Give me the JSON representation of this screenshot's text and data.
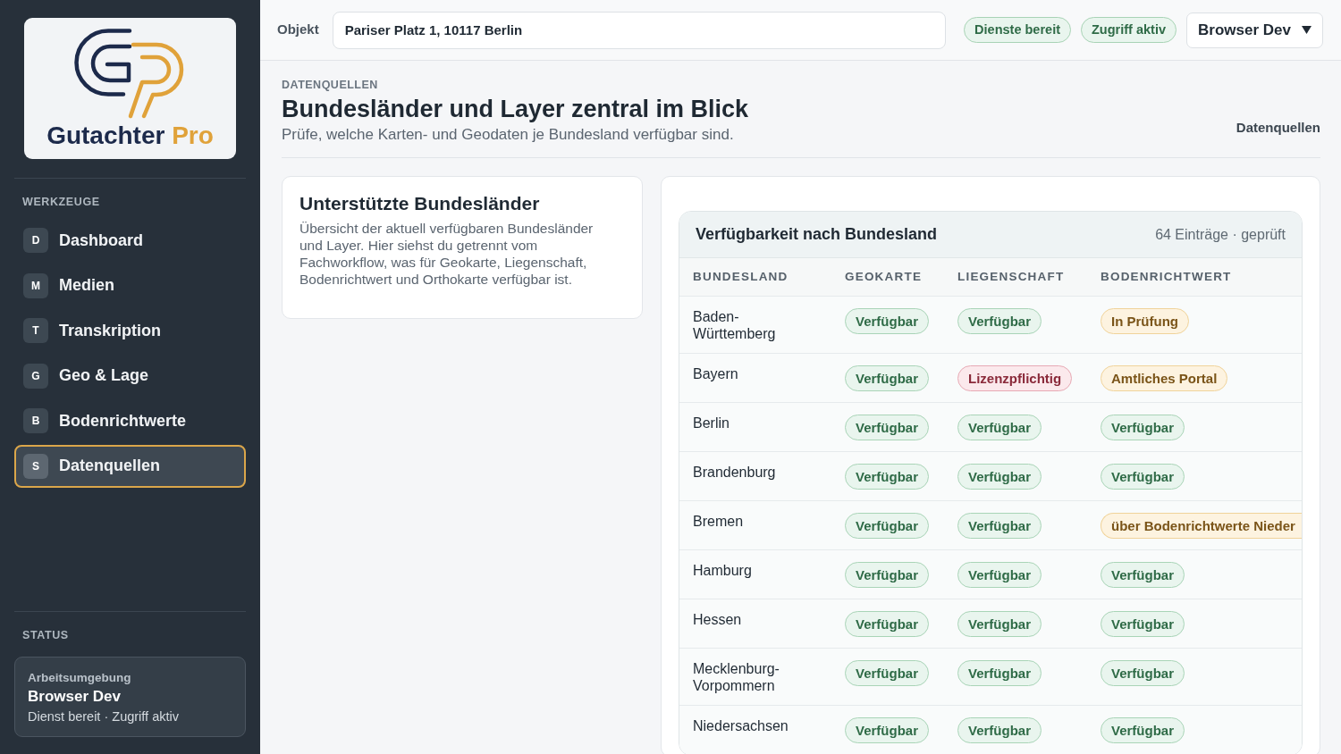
{
  "sidebar": {
    "logo": {
      "name": "Gutachter",
      "accent": "Pro"
    },
    "section_title": "WERKZEUGE",
    "items": [
      {
        "initial": "D",
        "label": "Dashboard",
        "selected": false
      },
      {
        "initial": "M",
        "label": "Medien",
        "selected": false
      },
      {
        "initial": "T",
        "label": "Transkription",
        "selected": false
      },
      {
        "initial": "G",
        "label": "Geo & Lage",
        "selected": false
      },
      {
        "initial": "B",
        "label": "Bodenrichtwerte",
        "selected": false
      },
      {
        "initial": "S",
        "label": "Datenquellen",
        "selected": true
      }
    ],
    "status_title": "STATUS",
    "status": {
      "label": "Arbeitsumgebung",
      "value": "Browser Dev",
      "detail": "Dienst bereit · Zugriff aktiv"
    }
  },
  "top_bar": {
    "field_label": "Objekt",
    "field_value": "Pariser Platz 1, 10117 Berlin",
    "badges": [
      "Dienste bereit",
      "Zugriff aktiv"
    ],
    "environment": "Browser Dev"
  },
  "header": {
    "eyebrow": "DATENQUELLEN",
    "title": "Bundesländer und Layer zentral im Blick",
    "subtitle": "Prüfe, welche Karten- und Geodaten je Bundesland verfügbar sind.",
    "breadcrumb": "Datenquellen"
  },
  "info_card": {
    "title": "Unterstützte Bundesländer",
    "text": "Übersicht der aktuell verfügbaren Bundesländer und Layer. Hier siehst du getrennt vom Fachworkflow, was für Geokarte, Liegenschaft, Bodenrichtwert und Orthokarte verfügbar ist."
  },
  "table": {
    "title": "Verfügbarkeit nach Bundesland",
    "meta": "64 Einträge · geprüft",
    "columns": [
      "BUNDESLAND",
      "GEOKARTE",
      "LIEGENSCHAFT",
      "BODENRICHTWERT"
    ],
    "rows": [
      {
        "cells": [
          {
            "text": "Baden-Württemberg",
            "kind": "label"
          },
          {
            "text": "Verfügbar",
            "kind": "ok"
          },
          {
            "text": "Verfügbar",
            "kind": "ok"
          },
          {
            "text": "In Prüfung",
            "kind": "pending"
          }
        ]
      },
      {
        "cells": [
          {
            "text": "Bayern",
            "kind": "label"
          },
          {
            "text": "Verfügbar",
            "kind": "ok"
          },
          {
            "text": "Lizenzpflichtig",
            "kind": "restricted"
          },
          {
            "text": "Amtliches Portal",
            "kind": "pending"
          }
        ]
      },
      {
        "cells": [
          {
            "text": "Berlin",
            "kind": "label"
          },
          {
            "text": "Verfügbar",
            "kind": "ok"
          },
          {
            "text": "Verfügbar",
            "kind": "ok"
          },
          {
            "text": "Verfügbar",
            "kind": "ok"
          }
        ]
      },
      {
        "cells": [
          {
            "text": "Brandenburg",
            "kind": "label"
          },
          {
            "text": "Verfügbar",
            "kind": "ok"
          },
          {
            "text": "Verfügbar",
            "kind": "ok"
          },
          {
            "text": "Verfügbar",
            "kind": "ok"
          }
        ]
      },
      {
        "cells": [
          {
            "text": "Bremen",
            "kind": "label"
          },
          {
            "text": "Verfügbar",
            "kind": "ok"
          },
          {
            "text": "Verfügbar",
            "kind": "ok"
          },
          {
            "text": "über Bodenrichtwerte Nieder",
            "kind": "pending"
          }
        ]
      },
      {
        "cells": [
          {
            "text": "Hamburg",
            "kind": "label"
          },
          {
            "text": "Verfügbar",
            "kind": "ok"
          },
          {
            "text": "Verfügbar",
            "kind": "ok"
          },
          {
            "text": "Verfügbar",
            "kind": "ok"
          }
        ]
      },
      {
        "cells": [
          {
            "text": "Hessen",
            "kind": "label"
          },
          {
            "text": "Verfügbar",
            "kind": "ok"
          },
          {
            "text": "Verfügbar",
            "kind": "ok"
          },
          {
            "text": "Verfügbar",
            "kind": "ok"
          }
        ]
      },
      {
        "cells": [
          {
            "text": "Mecklenburg-Vorpommern",
            "kind": "label"
          },
          {
            "text": "Verfügbar",
            "kind": "ok"
          },
          {
            "text": "Verfügbar",
            "kind": "ok"
          },
          {
            "text": "Verfügbar",
            "kind": "ok"
          }
        ]
      },
      {
        "cells": [
          {
            "text": "Niedersachsen",
            "kind": "label"
          },
          {
            "text": "Verfügbar",
            "kind": "ok"
          },
          {
            "text": "Verfügbar",
            "kind": "ok"
          },
          {
            "text": "Verfügbar",
            "kind": "ok"
          }
        ]
      }
    ]
  }
}
